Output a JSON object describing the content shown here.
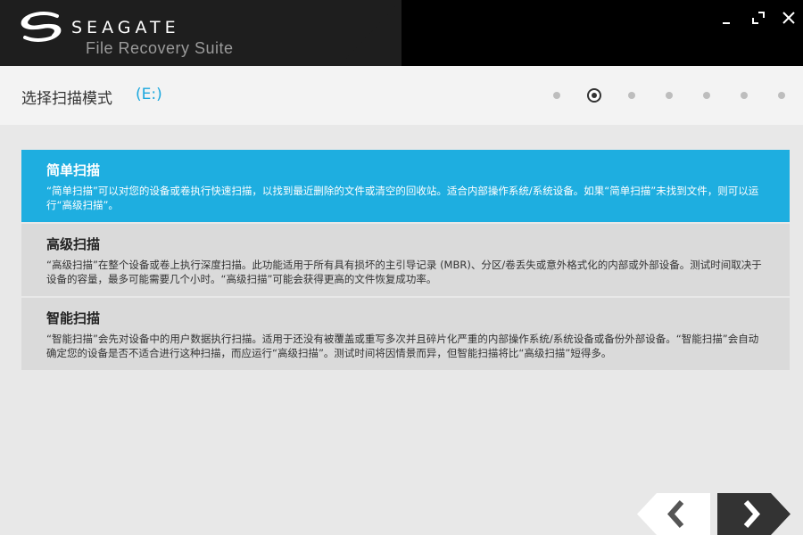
{
  "app": {
    "brand": "SEAGATE",
    "subtitle": "File Recovery Suite"
  },
  "page": {
    "title": "选择扫描模式",
    "drive": "(E:)"
  },
  "steps": {
    "count": 7,
    "active_index": 1
  },
  "options": [
    {
      "title": "简单扫描",
      "desc": "“简单扫描”可以对您的设备或卷执行快速扫描，以找到最近删除的文件或清空的回收站。适合内部操作系统/系统设备。如果“简单扫描”未找到文件，则可以运行“高级扫描”。",
      "selected": true
    },
    {
      "title": "高级扫描",
      "desc": "“高级扫描”在整个设备或卷上执行深度扫描。此功能适用于所有具有损坏的主引导记录 (MBR)、分区/卷丢失或意外格式化的内部或外部设备。测试时间取决于设备的容量，最多可能需要几个小时。“高级扫描”可能会获得更高的文件恢复成功率。",
      "selected": false
    },
    {
      "title": "智能扫描",
      "desc": "“智能扫描”会先对设备中的用户数据执行扫描。适用于还没有被覆盖或重写多次并且碎片化严重的内部操作系统/系统设备或备份外部设备。“智能扫描”会自动确定您的设备是否不适合进行这种扫描，而应运行“高级扫描”。测试时间将因情景而异，但智能扫描将比“高级扫描”短得多。",
      "selected": false
    }
  ],
  "colors": {
    "accent": "#1eaee0",
    "header_bg": "#000000",
    "nav_dark": "#333333"
  }
}
